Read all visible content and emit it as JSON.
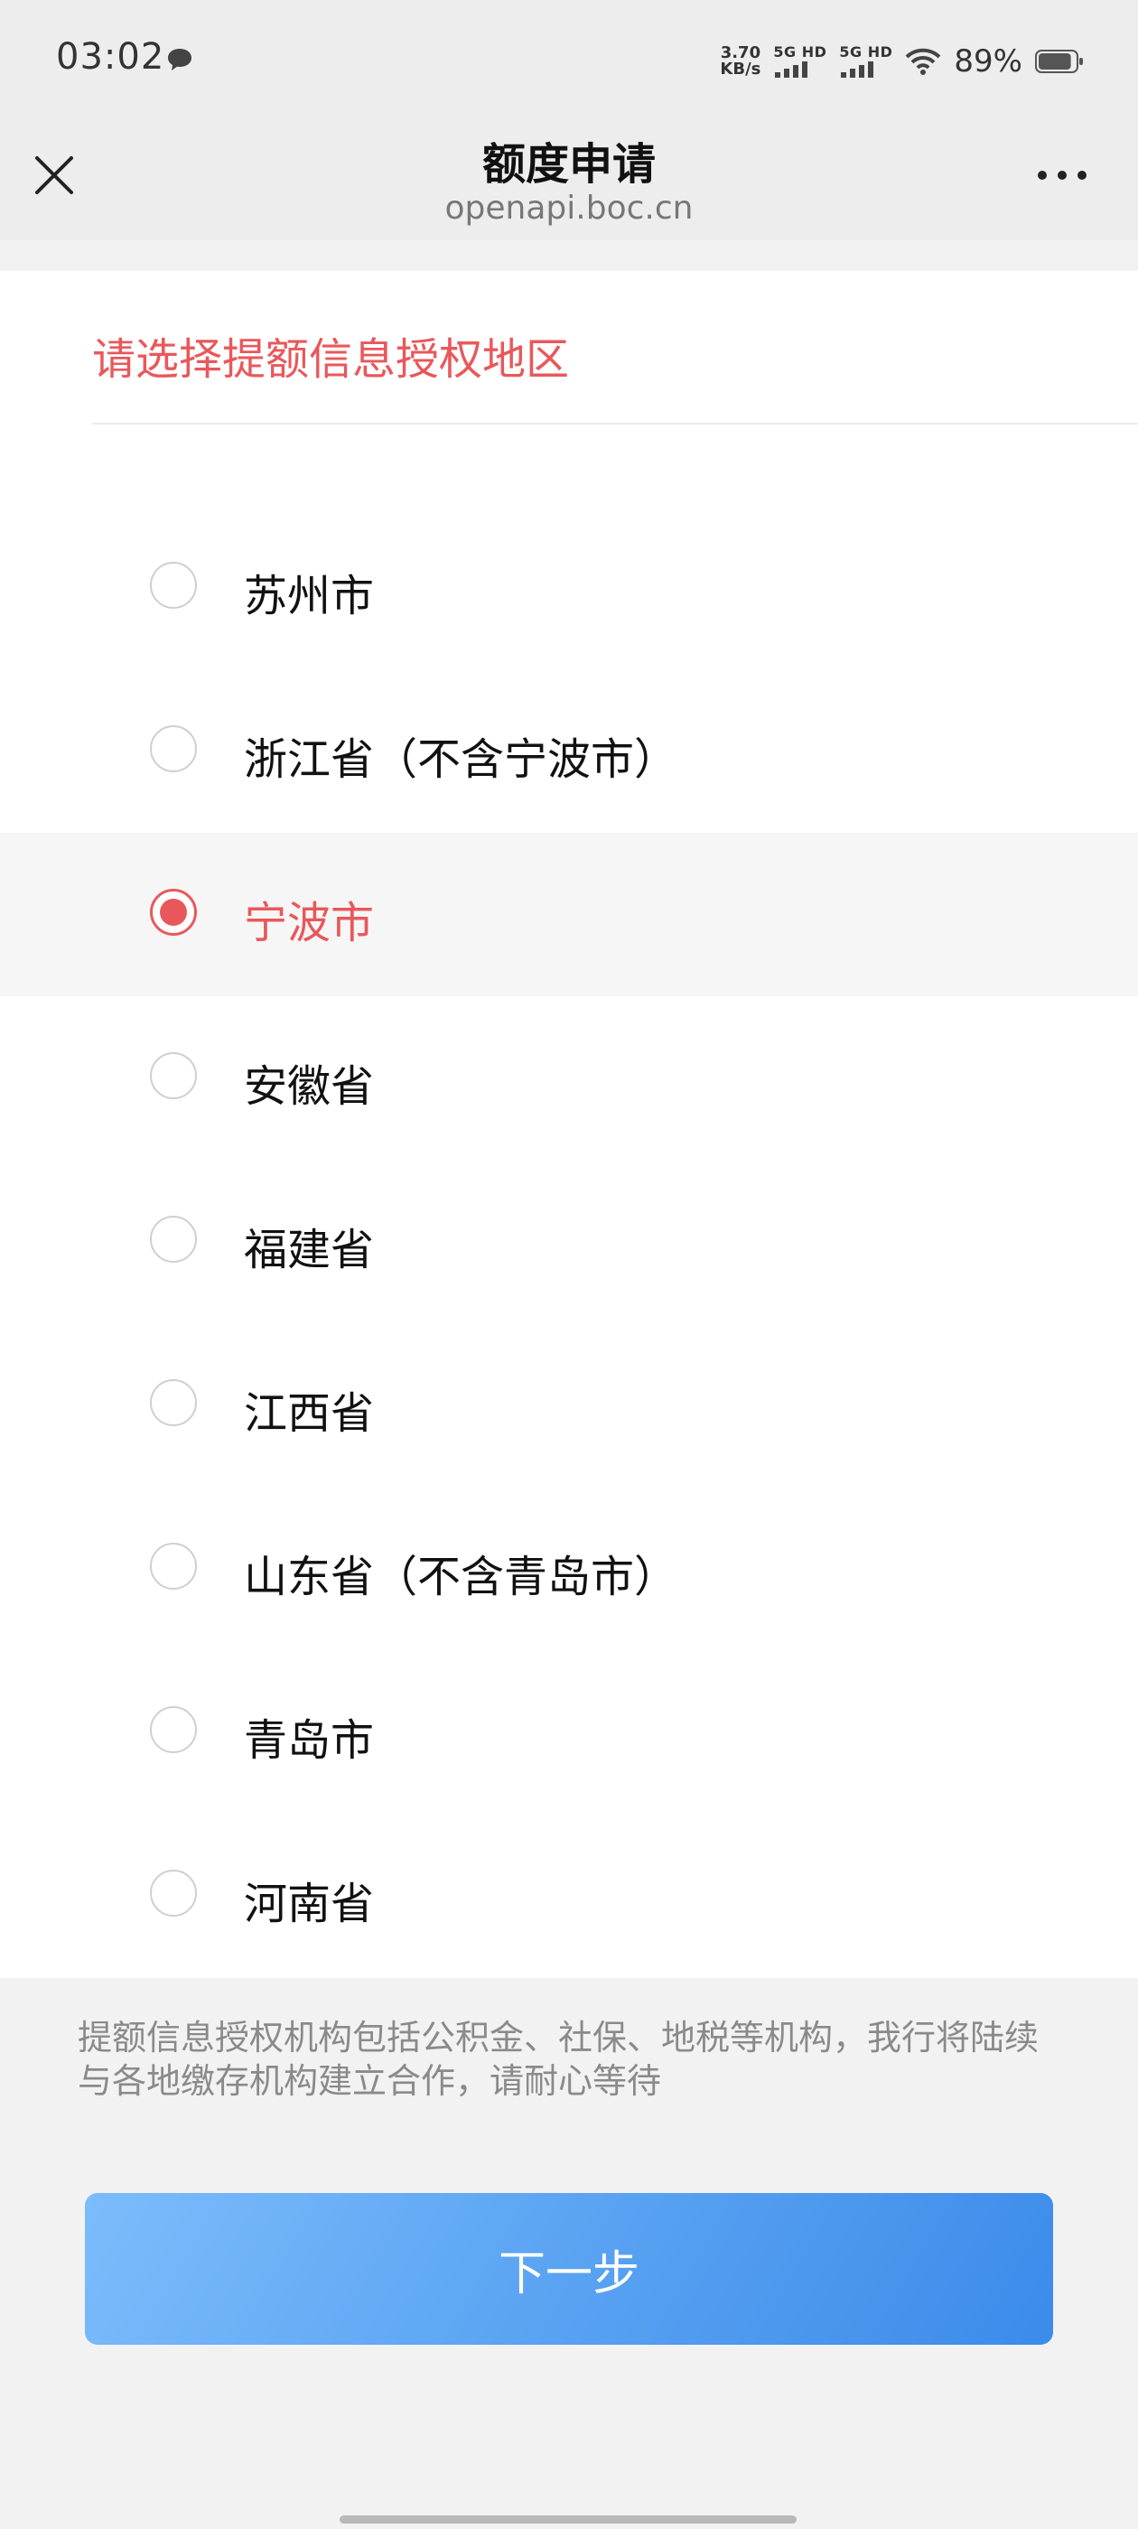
{
  "status_bar": {
    "time": "03:02",
    "net_speed_value": "3.70",
    "net_speed_unit": "KB/s",
    "sim1_label": "5G HD",
    "sim2_label": "5G HD",
    "battery_text": "89%",
    "battery_level": 0.89,
    "icons": [
      "chat-bubble-icon",
      "signal-icon",
      "wifi-icon",
      "battery-icon"
    ]
  },
  "nav": {
    "title": "额度申请",
    "subtitle": "openapi.boc.cn",
    "icons": [
      "close-icon",
      "more-icon"
    ]
  },
  "form": {
    "heading": "请选择提额信息授权地区",
    "selected": "宁波市",
    "options": [
      {
        "label": "苏州市",
        "selected": false
      },
      {
        "label": "浙江省（不含宁波市）",
        "selected": false
      },
      {
        "label": "宁波市",
        "selected": true
      },
      {
        "label": "安徽省",
        "selected": false
      },
      {
        "label": "福建省",
        "selected": false
      },
      {
        "label": "江西省",
        "selected": false
      },
      {
        "label": "山东省（不含青岛市）",
        "selected": false
      },
      {
        "label": "青岛市",
        "selected": false
      },
      {
        "label": "河南省",
        "selected": false
      }
    ]
  },
  "notice": "提额信息授权机构包括公积金、社保、地税等机构，我行将陆续与各地缴存机构建立合作，请耐心等待",
  "next_button_label": "下一步",
  "colors": {
    "accent": "#e8585b",
    "button_start": "#7cbcfb",
    "button_end": "#3b8bea"
  }
}
